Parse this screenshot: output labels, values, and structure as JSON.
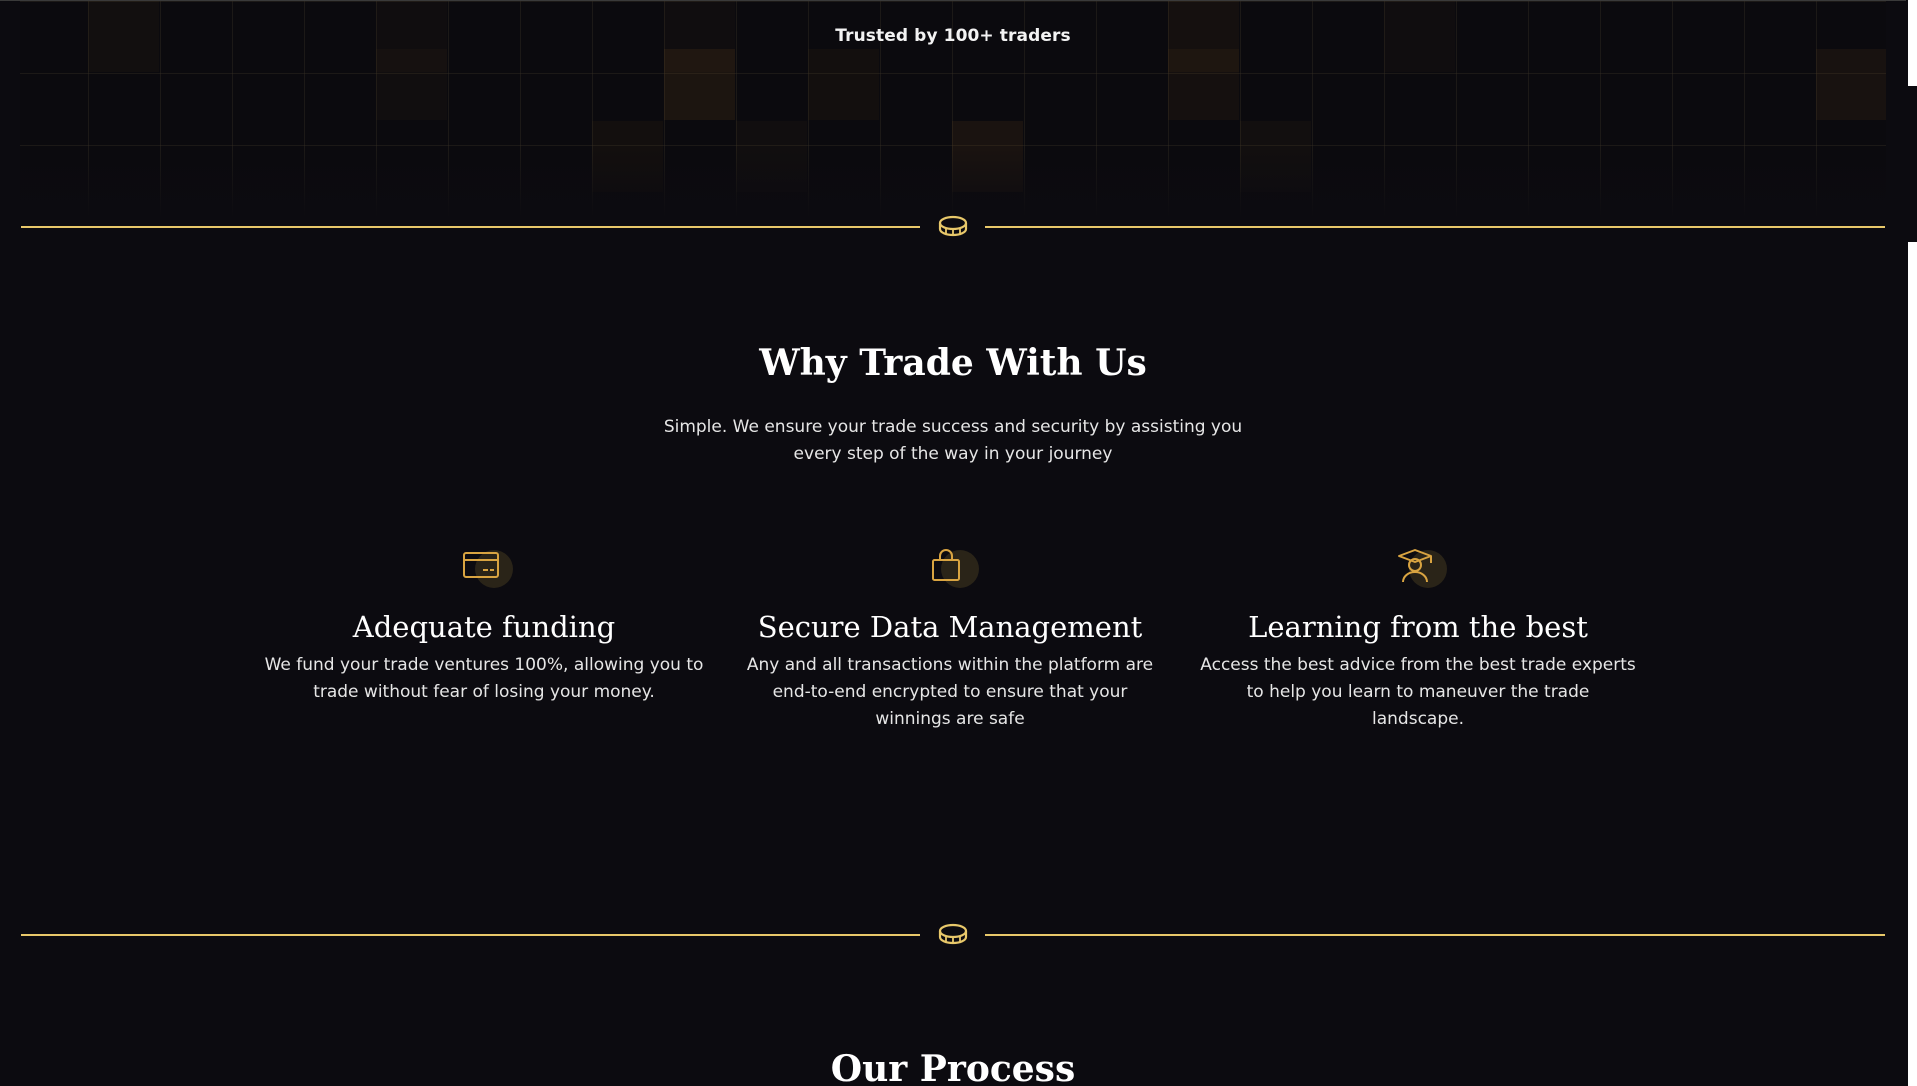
{
  "hero": {
    "trusted_text": "Trusted by 100+ traders"
  },
  "why": {
    "title": "Why Trade With Us",
    "subtitle": "Simple. We ensure your trade success and security by assisting you every step of the way in your journey"
  },
  "features": [
    {
      "icon": "credit-card-icon",
      "title": "Adequate funding",
      "description": "We fund your trade ventures 100%, allowing you to trade without fear of losing your money."
    },
    {
      "icon": "shopping-bag-icon",
      "title": "Secure Data Management",
      "description": "Any and all transactions within the platform are end-to-end encrypted to ensure that your winnings are safe"
    },
    {
      "icon": "graduate-icon",
      "title": "Learning from the best",
      "description": "Access the best advice from the best trade experts to help you learn to maneuver the trade landscape."
    }
  ],
  "process": {
    "title": "Our Process"
  },
  "colors": {
    "background": "#0c0b10",
    "accent_gold": "#e8c86a",
    "icon_gold": "#d9a441"
  }
}
